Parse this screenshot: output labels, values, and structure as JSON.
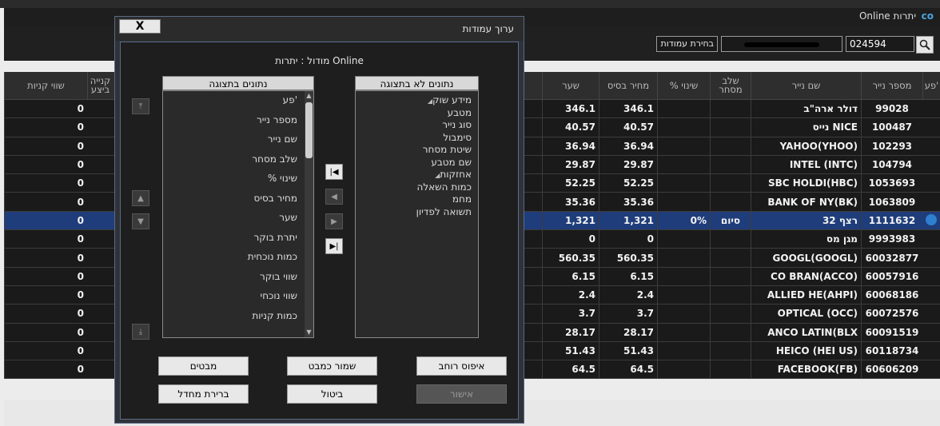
{
  "app": {
    "title": "Online יתרות",
    "icon": "link-icon"
  },
  "toolbar": {
    "security_value": "024594",
    "columns_button": "בחירת עמודות",
    "search_icon": "search-icon"
  },
  "grid": {
    "headers": [
      "פע'",
      "מספר נייר",
      "שם נייר",
      "שלב מסחר",
      "% שינוי",
      "מחיר בסיס",
      "שער",
      "קנייה ביצע",
      "שווי קניות"
    ],
    "rows": [
      {
        "id": "99028",
        "name": "דולר ארה\"ב",
        "stage": "",
        "change": "",
        "base": "346.1",
        "rate": "346.1",
        "buy": "0"
      },
      {
        "id": "100487",
        "name": "נייס    NICE",
        "stage": "",
        "change": "",
        "base": "40.57",
        "rate": "40.57",
        "buy": "0"
      },
      {
        "id": "102293",
        "name": "YAHOO(YHOO)",
        "stage": "",
        "change": "",
        "base": "36.94",
        "rate": "36.94",
        "buy": "0"
      },
      {
        "id": "104794",
        "name": "INTEL (INTC)",
        "stage": "",
        "change": "",
        "base": "29.87",
        "rate": "29.87",
        "buy": "0"
      },
      {
        "id": "1053693",
        "name": "SBC HOLDI(HBC)",
        "stage": "",
        "change": "",
        "base": "52.25",
        "rate": "52.25",
        "buy": "0"
      },
      {
        "id": "1063809",
        "name": "BANK OF NY(BK)",
        "stage": "",
        "change": "",
        "base": "35.36",
        "rate": "35.36",
        "buy": "0"
      },
      {
        "id": "1111632",
        "name": "רצף 32",
        "stage": "סיום",
        "change": "0%",
        "base": "1,321",
        "rate": "1,321",
        "buy": "0",
        "selected": true
      },
      {
        "id": "9993983",
        "name": "מגן מס",
        "stage": "",
        "change": "",
        "base": "0",
        "rate": "0",
        "buy": "0"
      },
      {
        "id": "60032877",
        "name": "GOOGL(GOOGL)",
        "stage": "",
        "change": "",
        "base": "560.35",
        "rate": "560.35",
        "buy": "0"
      },
      {
        "id": "60057916",
        "name": "CO BRAN(ACCO)",
        "stage": "",
        "change": "",
        "base": "6.15",
        "rate": "6.15",
        "buy": "0"
      },
      {
        "id": "60068186",
        "name": "ALLIED HE(AHPI)",
        "stage": "",
        "change": "",
        "base": "2.4",
        "rate": "2.4",
        "buy": "0"
      },
      {
        "id": "60072576",
        "name": "OPTICAL (OCC)",
        "stage": "",
        "change": "",
        "base": "3.7",
        "rate": "3.7",
        "buy": "0"
      },
      {
        "id": "60091519",
        "name": "ANCO LATIN(BLX",
        "stage": "",
        "change": "",
        "base": "28.17",
        "rate": "28.17",
        "buy": "0"
      },
      {
        "id": "60118734",
        "name": "HEICO (HEI US)",
        "stage": "",
        "change": "",
        "base": "51.43",
        "rate": "51.43",
        "buy": "0"
      },
      {
        "id": "60606209",
        "name": "FACEBOOK(FB)",
        "stage": "",
        "change": "",
        "base": "64.5",
        "rate": "64.5",
        "buy": "0"
      }
    ]
  },
  "dialog": {
    "title": "ערוך עמודות",
    "close_label": "X",
    "module_label": "מודול : יתרות Online",
    "hidden_header": "נתונים לא בתצוגה",
    "shown_header": "נתונים בתצוגה",
    "hidden_items": [
      {
        "label": "מידע שוק",
        "group": true
      },
      {
        "label": "מטבע"
      },
      {
        "label": "סוג נייר"
      },
      {
        "label": "סימבול"
      },
      {
        "label": "שיטת מסחר"
      },
      {
        "label": "שם מטבע"
      },
      {
        "label": "אחזקות",
        "group": true
      },
      {
        "label": "כמות השאלה"
      },
      {
        "label": "מחמ"
      },
      {
        "label": "תשואה לפדיון"
      }
    ],
    "shown_items": [
      "פע'",
      "מספר נייר",
      "שם נייר",
      "שלב מסחר",
      "% שינוי",
      "מחיר בסיס",
      "שער",
      "יתרת בוקר",
      "כמות נוכחית",
      "שווי בוקר",
      "שווי נוכחי",
      "כמות קניות"
    ],
    "buttons": {
      "reset_width": "איפוס רוחב",
      "save_template": "שמור כמבט",
      "templates": "מבטים",
      "ok": "אישור",
      "cancel": "ביטול",
      "default": "ברירת מחדל"
    }
  }
}
